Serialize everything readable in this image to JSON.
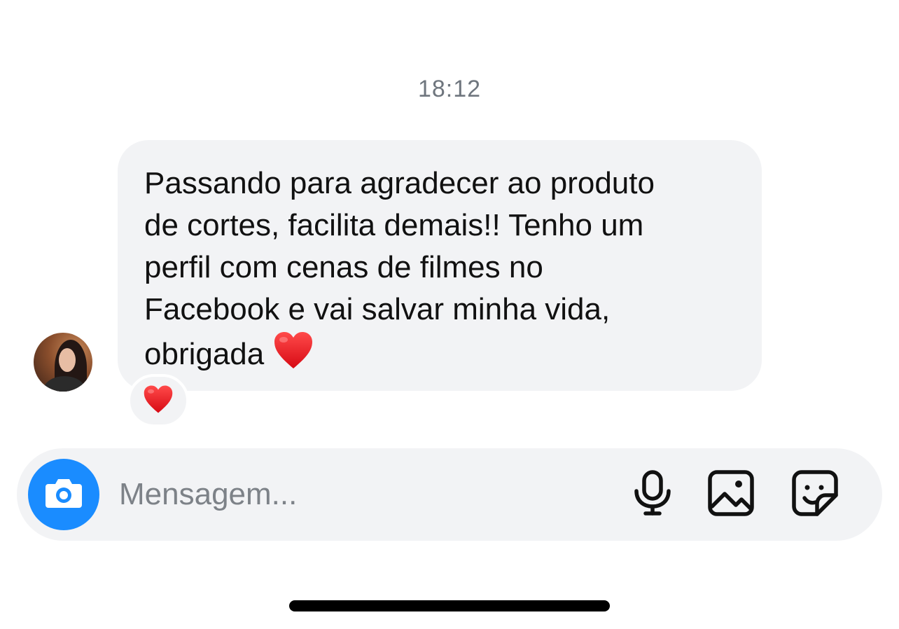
{
  "chat": {
    "timestamp": "18:12",
    "message": {
      "text": "Passando para agradecer ao produto\nde cortes, facilita demais!! Tenho um\nperfil com cenas de filmes no\nFacebook e vai salvar minha vida,\nobrigada",
      "emoji": "heart"
    },
    "reaction": "heart"
  },
  "composer": {
    "placeholder": "Mensagem...",
    "icons": [
      "camera-icon",
      "microphone-icon",
      "image-icon",
      "sticker-icon"
    ]
  },
  "colors": {
    "accent": "#1a8cff",
    "bubble": "#f2f3f5",
    "heart": "#e8141e"
  }
}
